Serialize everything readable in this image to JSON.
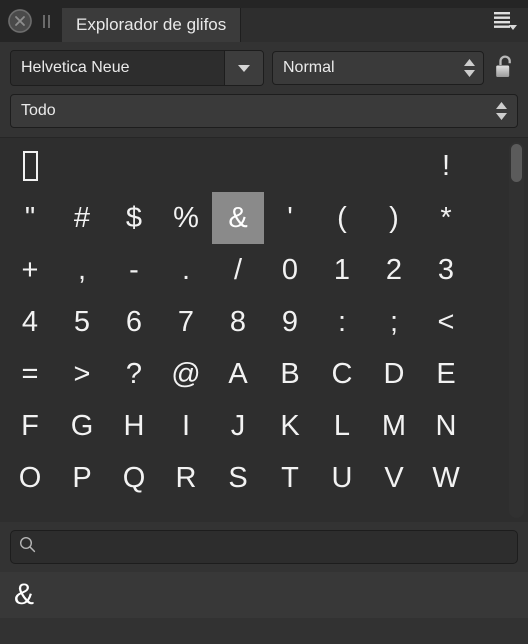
{
  "titlebar": {
    "close_icon": "close-circle-icon",
    "drag_icon": "drag-handle-icon",
    "tab_label": "Explorador de glifos",
    "menu_icon": "hamburger-menu-icon"
  },
  "controls": {
    "font_name": "Helvetica Neue",
    "font_dropdown_icon": "chevron-down-icon",
    "style_value": "Normal",
    "style_stepper_icon": "stepper-arrows-icon",
    "lock_icon": "unlocked-padlock-icon",
    "filter_value": "Todo",
    "filter_stepper_icon": "stepper-arrows-icon"
  },
  "grid": {
    "columns": 9,
    "selected_glyph": "&",
    "cells": [
      {
        "char": "",
        "type": "notdef"
      },
      {
        "char": "",
        "type": "empty"
      },
      {
        "char": "",
        "type": "empty"
      },
      {
        "char": "",
        "type": "empty"
      },
      {
        "char": "",
        "type": "empty"
      },
      {
        "char": "",
        "type": "empty"
      },
      {
        "char": "",
        "type": "empty"
      },
      {
        "char": "",
        "type": "empty"
      },
      {
        "char": "!",
        "type": "glyph"
      },
      {
        "char": "\"",
        "type": "glyph"
      },
      {
        "char": "#",
        "type": "glyph"
      },
      {
        "char": "$",
        "type": "glyph"
      },
      {
        "char": "%",
        "type": "glyph"
      },
      {
        "char": "&",
        "type": "glyph",
        "selected": true
      },
      {
        "char": "'",
        "type": "glyph"
      },
      {
        "char": "(",
        "type": "glyph"
      },
      {
        "char": ")",
        "type": "glyph"
      },
      {
        "char": "*",
        "type": "glyph"
      },
      {
        "char": "+",
        "type": "glyph"
      },
      {
        "char": ",",
        "type": "glyph"
      },
      {
        "char": "-",
        "type": "glyph"
      },
      {
        "char": ".",
        "type": "glyph"
      },
      {
        "char": "/",
        "type": "glyph"
      },
      {
        "char": "0",
        "type": "glyph"
      },
      {
        "char": "1",
        "type": "glyph"
      },
      {
        "char": "2",
        "type": "glyph"
      },
      {
        "char": "3",
        "type": "glyph"
      },
      {
        "char": "4",
        "type": "glyph"
      },
      {
        "char": "5",
        "type": "glyph"
      },
      {
        "char": "6",
        "type": "glyph"
      },
      {
        "char": "7",
        "type": "glyph"
      },
      {
        "char": "8",
        "type": "glyph"
      },
      {
        "char": "9",
        "type": "glyph"
      },
      {
        "char": ":",
        "type": "glyph"
      },
      {
        "char": ";",
        "type": "glyph"
      },
      {
        "char": "<",
        "type": "glyph"
      },
      {
        "char": "=",
        "type": "glyph"
      },
      {
        "char": ">",
        "type": "glyph"
      },
      {
        "char": "?",
        "type": "glyph"
      },
      {
        "char": "@",
        "type": "glyph"
      },
      {
        "char": "A",
        "type": "glyph"
      },
      {
        "char": "B",
        "type": "glyph"
      },
      {
        "char": "C",
        "type": "glyph"
      },
      {
        "char": "D",
        "type": "glyph"
      },
      {
        "char": "E",
        "type": "glyph"
      },
      {
        "char": "F",
        "type": "glyph"
      },
      {
        "char": "G",
        "type": "glyph"
      },
      {
        "char": "H",
        "type": "glyph"
      },
      {
        "char": "I",
        "type": "glyph"
      },
      {
        "char": "J",
        "type": "glyph"
      },
      {
        "char": "K",
        "type": "glyph"
      },
      {
        "char": "L",
        "type": "glyph"
      },
      {
        "char": "M",
        "type": "glyph"
      },
      {
        "char": "N",
        "type": "glyph"
      },
      {
        "char": "O",
        "type": "glyph"
      },
      {
        "char": "P",
        "type": "glyph"
      },
      {
        "char": "Q",
        "type": "glyph"
      },
      {
        "char": "R",
        "type": "glyph"
      },
      {
        "char": "S",
        "type": "glyph"
      },
      {
        "char": "T",
        "type": "glyph"
      },
      {
        "char": "U",
        "type": "glyph"
      },
      {
        "char": "V",
        "type": "glyph"
      },
      {
        "char": "W",
        "type": "glyph"
      }
    ]
  },
  "search": {
    "icon": "search-icon",
    "value": "",
    "placeholder": ""
  },
  "preview": {
    "glyph": "&"
  },
  "colors": {
    "panel_bg": "#333333",
    "titlebar_bg": "#252525",
    "tab_active_bg": "#3b3b3b",
    "grid_bg": "#2e2e2e",
    "selection_bg": "#8a8a8a",
    "glyph_fg": "#f2f2f2",
    "field_bg": "#2d2d2d",
    "preview_bg": "#383838"
  }
}
